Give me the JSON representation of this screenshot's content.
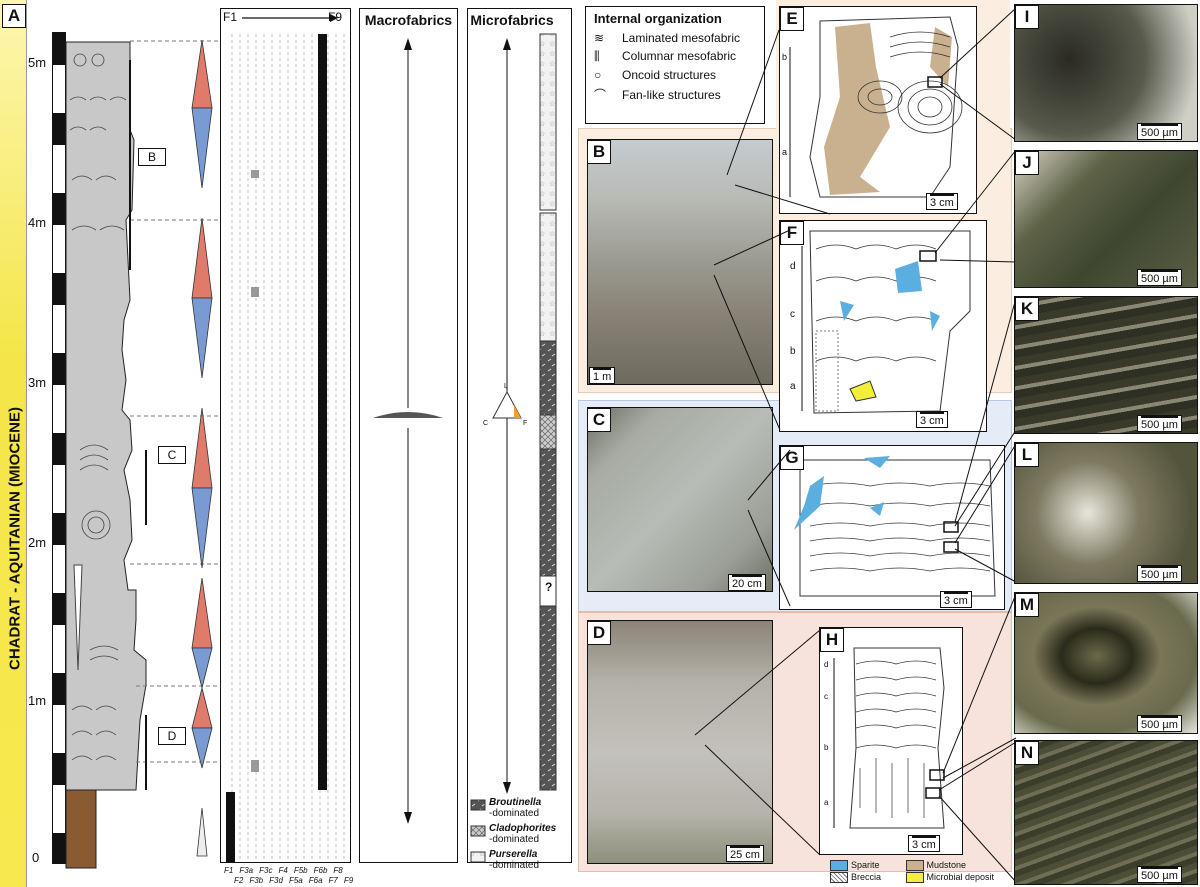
{
  "panels": {
    "A": "A",
    "B": "B",
    "C": "C",
    "D": "D",
    "E": "E",
    "F": "F",
    "G": "G",
    "H": "H",
    "I": "I",
    "J": "J",
    "K": "K",
    "L": "L",
    "M": "M",
    "N": "N"
  },
  "side_label": "CHADRAT - AQUITANIAN (MIOCENE)",
  "depth_ticks": [
    "0",
    "1m",
    "2m",
    "3m",
    "4m",
    "5m"
  ],
  "log_callouts": [
    "B",
    "C",
    "D"
  ],
  "facies": {
    "header_left": "F1",
    "header_right": "F9",
    "bottom_row1": [
      "F1",
      "F3a",
      "F3c",
      "F4",
      "F5b",
      "F6b",
      "F8"
    ],
    "bottom_row2": [
      "F2",
      "F3b",
      "F3d",
      "F5a",
      "F6a",
      "F7",
      "F9"
    ]
  },
  "columns": {
    "macro": "Macrofabrics",
    "micro": "Microfabrics"
  },
  "triangle": {
    "top": "L",
    "left": "C",
    "right": "F"
  },
  "micro_question": "?",
  "micro_legend": [
    {
      "name": "Broutinella",
      "suffix": "-dominated"
    },
    {
      "name": "Cladophorites",
      "suffix": "-dominated"
    },
    {
      "name": "Purserella",
      "suffix": "-dominated"
    }
  ],
  "internal_org": {
    "title": "Internal organization",
    "items": [
      "Laminated mesofabric",
      "Columnar mesofabric",
      "Oncoid structures",
      "Fan-like structures"
    ]
  },
  "scales": {
    "B": "1 m",
    "C": "20 cm",
    "D": "25 cm",
    "E": "3 cm",
    "F": "3 cm",
    "G": "3 cm",
    "H": "3 cm",
    "micro": "500 µm"
  },
  "sublabels": {
    "E": [
      "b",
      "a"
    ],
    "F": [
      "d",
      "c",
      "b",
      "a"
    ],
    "H": [
      "d",
      "c",
      "b",
      "a"
    ]
  },
  "bottom_legend": [
    "Sparite",
    "Mudstone",
    "Breccia",
    "Microbial deposit"
  ],
  "colors": {
    "sidebar_yellow": "#f4e64a",
    "rock_grey": "#c8c8c8",
    "soil_brown": "#8a5a32",
    "cycle_red": "#e07a6a",
    "cycle_blue": "#7a9ad4",
    "sparite": "#5aaee0",
    "mudstone": "#c9b08f",
    "microbial": "#f2ee3a",
    "bg_beige": "#fbeee0",
    "bg_blue": "#e6ecf7",
    "bg_pink": "#f8e3dc"
  }
}
